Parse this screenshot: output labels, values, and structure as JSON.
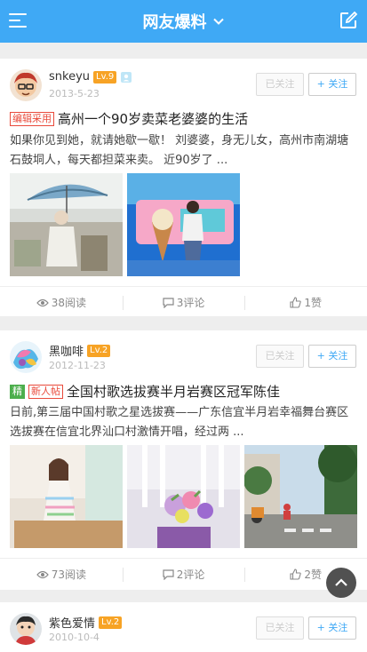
{
  "header": {
    "title": "网友爆料"
  },
  "posts": [
    {
      "username": "snkeyu",
      "level": "Lv.9",
      "date": "2013-5-23",
      "followed_label": "已关注",
      "follow_label": "+ 关注",
      "tags": [
        "编辑采用"
      ],
      "title": "高州一个90岁卖菜老婆婆的生活",
      "excerpt": "如果你见到她，就请她歇一歇！ 刘婆婆，身无儿女，高州市南湖塘石鼓垌人，每天都担菜来卖。 近90岁了 ...",
      "reads": "38阅读",
      "comments": "3评论",
      "likes": "1赞"
    },
    {
      "username": "黑咖啡",
      "level": "Lv.2",
      "date": "2012-11-23",
      "followed_label": "已关注",
      "follow_label": "+ 关注",
      "tags": [
        "精",
        "新人帖"
      ],
      "title": "全国村歌选拔赛半月岩赛区冠军陈佳",
      "excerpt": "日前,第三届中国村歌之星选拔赛——广东信宜半月岩幸福舞台赛区选拔赛在信宜北界汕口村激情开唱，经过两 ...",
      "reads": "73阅读",
      "comments": "2评论",
      "likes": "2赞"
    },
    {
      "username": "紫色爱情",
      "level": "Lv.2",
      "date": "2010-10-4",
      "followed_label": "已关注",
      "follow_label": "+ 关注"
    }
  ],
  "colors": {
    "header": "#3fa9f5",
    "level_badge": "#f7a325",
    "tag_red": "#e94b3c",
    "tag_green": "#4cae4c"
  }
}
